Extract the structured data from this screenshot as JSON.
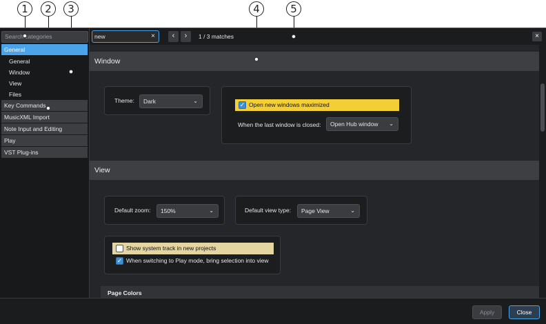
{
  "callouts": [
    "1",
    "2",
    "3",
    "4",
    "5"
  ],
  "sidebar": {
    "search_placeholder": "Search categories",
    "items": [
      {
        "label": "General",
        "selected": true
      },
      {
        "label": "General",
        "sub": true
      },
      {
        "label": "Window",
        "sub": true
      },
      {
        "label": "View",
        "sub": true
      },
      {
        "label": "Files",
        "sub": true
      },
      {
        "label": "Key Commands"
      },
      {
        "label": "MusicXML Import"
      },
      {
        "label": "Note Input and Editing"
      },
      {
        "label": "Play"
      },
      {
        "label": "VST Plug-ins"
      }
    ]
  },
  "search": {
    "value": "new",
    "clear_glyph": "×",
    "prev_glyph": "‹",
    "next_glyph": "›",
    "match_count": "1 / 3 matches",
    "close_glyph": "×"
  },
  "window_section": {
    "title": "Window",
    "theme_label": "Theme:",
    "theme_value": "Dark",
    "maximize_label": "Open new windows maximized",
    "maximize_checked": true,
    "last_closed_label": "When the last window is closed:",
    "last_closed_value": "Open Hub window"
  },
  "view_section": {
    "title": "View",
    "zoom_label": "Default zoom:",
    "zoom_value": "150%",
    "view_type_label": "Default view type:",
    "view_type_value": "Page View",
    "system_track_label": "Show system track in new projects",
    "system_track_checked": false,
    "play_mode_label": "When switching to Play mode, bring selection into view",
    "play_mode_checked": true,
    "page_colors_label": "Page Colors"
  },
  "footer": {
    "apply_label": "Apply",
    "close_label": "Close"
  },
  "colors": {
    "accent": "#4ba3e9",
    "highlight": "#f3cf35",
    "background": "#1b1c1e"
  },
  "icons": {
    "chevron": "chevron-down-icon",
    "check": "check-icon"
  }
}
